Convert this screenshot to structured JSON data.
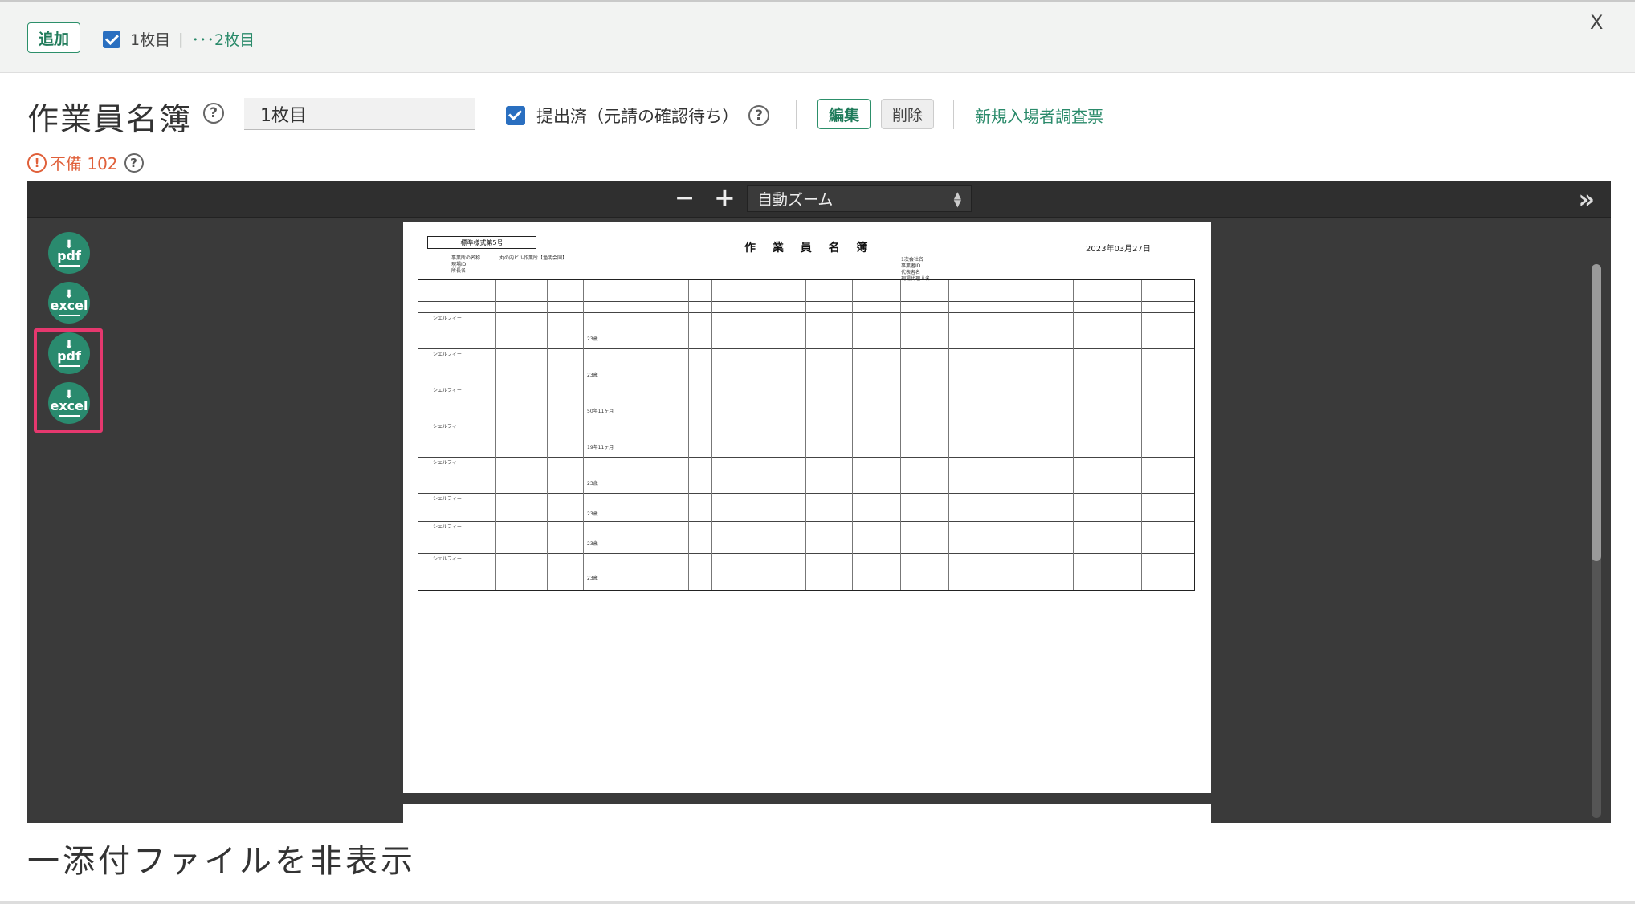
{
  "topbar": {
    "add_label": "追加",
    "tab1_label": "1枚目",
    "tab2_label": "･･･2枚目",
    "close_label": "X"
  },
  "header": {
    "title": "作業員名簿",
    "page_value": "1枚目",
    "submitted_label": "提出済（元請の確認待ち）",
    "edit_label": "編集",
    "delete_label": "削除",
    "new_entry_link": "新規入場者調査票",
    "defect_label": "不備 102"
  },
  "viewer": {
    "zoom_label": "自動ズーム",
    "download_buttons": [
      {
        "label": "pdf",
        "icon": "download-icon"
      },
      {
        "label": "excel",
        "icon": "download-icon"
      },
      {
        "label": "pdf",
        "icon": "download-icon"
      },
      {
        "label": "excel",
        "icon": "download-icon"
      }
    ]
  },
  "document": {
    "form_label": "標準様式第5号",
    "title": "作 業 員 名 簿",
    "date": "2023年03月27日",
    "office_name": "丸の内ビル作業所【過明会同】",
    "company_rows": [
      "1次会社名",
      "事業者ID",
      "代表者名",
      "現場代理人名"
    ],
    "worker_names": [
      "シェルフィー",
      "シェルフィー",
      "シェルフィー",
      "シェルフィー",
      "シェルフィー",
      "シェルフィー",
      "シェルフィー",
      "シェルフィー"
    ],
    "ages": [
      "23歳",
      "23歳",
      "50年11ヶ月",
      "19年11ヶ月",
      "23歳",
      "23歳",
      "23歳",
      "23歳"
    ]
  },
  "footer": {
    "hide_attachments": "一添付ファイルを非表示"
  }
}
